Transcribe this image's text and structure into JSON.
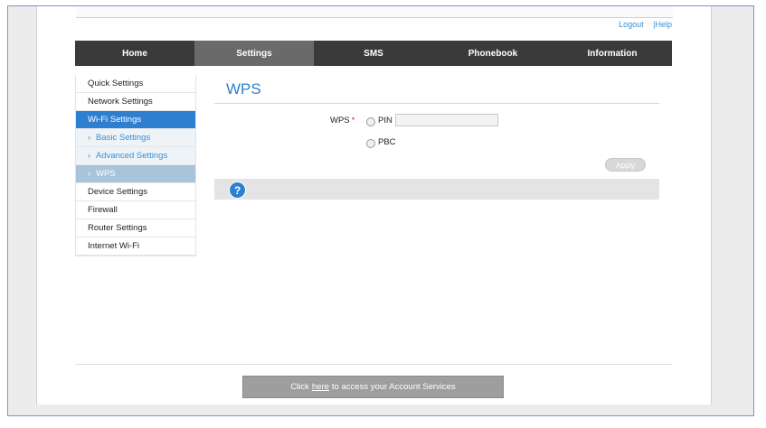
{
  "header": {
    "logout": "Logout",
    "separator": "|",
    "help": "Help"
  },
  "nav": {
    "tabs": [
      "Home",
      "Settings",
      "SMS",
      "Phonebook",
      "Information"
    ],
    "active": "Settings"
  },
  "sidebar": {
    "items": [
      "Quick Settings",
      "Network Settings",
      "Wi-Fi Settings"
    ],
    "sub_items": [
      "Basic Settings",
      "Advanced Settings",
      "WPS"
    ],
    "items_after": [
      "Device Settings",
      "Firewall",
      "Router Settings",
      "Internet Wi-Fi"
    ],
    "chevron_icon": "›"
  },
  "main": {
    "title": "WPS",
    "wps_label": "WPS",
    "required_mark": "*",
    "options": [
      "PIN",
      "PBC"
    ],
    "pin_value": "",
    "apply_label": "Apply",
    "help_icon": "?"
  },
  "footer": {
    "prefix": "Click",
    "link": "here",
    "suffix": "to access your Account Services"
  },
  "colors": {
    "accent": "#2f7fd1",
    "nav_bg": "#3a3a3a",
    "nav_active": "#6a6a6a"
  }
}
